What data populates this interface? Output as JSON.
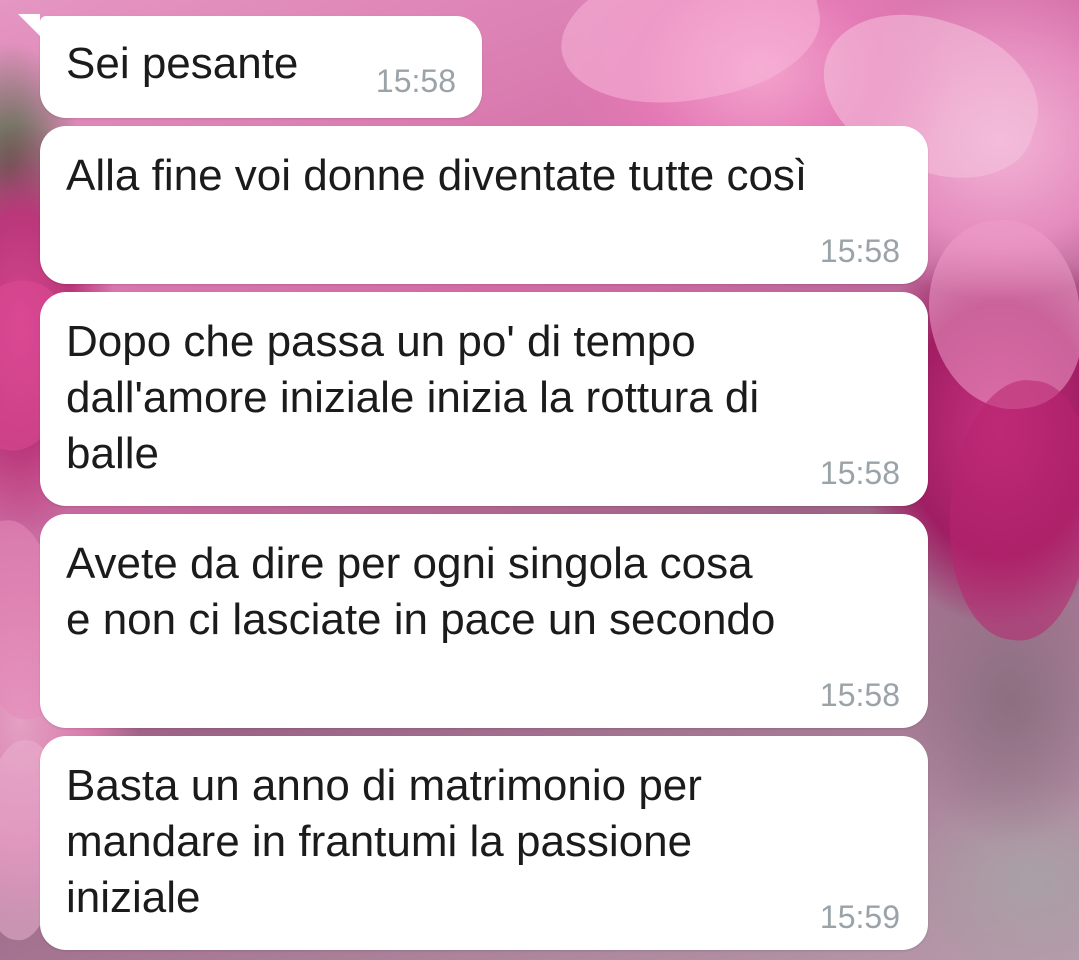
{
  "messages": [
    {
      "text": "Sei pesante",
      "time": "15:58"
    },
    {
      "text": "Alla fine voi donne diventate tutte così",
      "time": "15:58"
    },
    {
      "text": "Dopo che passa un po' di tempo\ndall'amore iniziale inizia la rottura di\nballe",
      "time": "15:58"
    },
    {
      "text": "Avete da dire per ogni singola cosa\ne non ci lasciate in pace un secondo",
      "time": "15:58"
    },
    {
      "text": "Basta un anno di matrimonio per\nmandare in frantumi la passione\niniziale",
      "time": "15:59"
    }
  ],
  "colors": {
    "bubble": "#ffffff",
    "text": "#1b1b1b",
    "timestamp": "#9aa3a7"
  },
  "icons": {
    "wallpaper": "pink-peony-flowers-wallpaper"
  }
}
